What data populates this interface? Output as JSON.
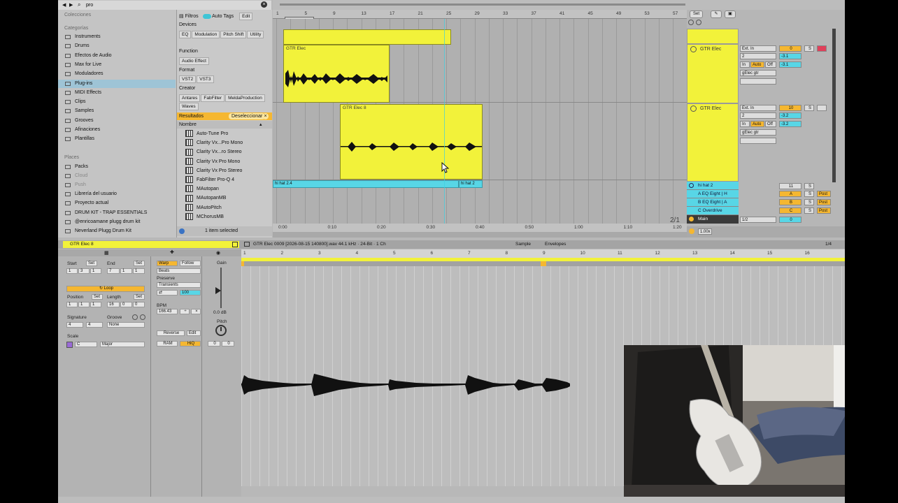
{
  "browser": {
    "search_value": "pro",
    "collections_header": "Colecciones",
    "categories_header": "Categorías",
    "categories": [
      "Instruments",
      "Drums",
      "Efectos de Audio",
      "Max for Live",
      "Moduladores",
      "Plug-ins",
      "MIDI Effects",
      "Clips",
      "Samples",
      "Grooves",
      "Afinaciones",
      "Plantillas"
    ],
    "selected_category": "Plug-ins",
    "places_header": "Places",
    "places": [
      "Packs",
      "Cloud",
      "Push",
      "Librería del usuario",
      "Proyecto actual",
      "DRUM KIT - TRAP ESSENTIALS",
      "@enricoamane plugg drum kit",
      "Neverland Plugg Drum Kit"
    ],
    "filters_label": "Filtros",
    "auto_tags_label": "Auto Tags",
    "edit_label": "Edit",
    "devices_label": "Devices",
    "device_tags": [
      "EQ",
      "Modulation",
      "Pitch Shift",
      "Utility"
    ],
    "function_label": "Function",
    "function_tags": [
      "Audio Effect"
    ],
    "format_label": "Format",
    "format_tags": [
      "VST2",
      "VST3"
    ],
    "creator_label": "Creator",
    "creator_tags": [
      "Antares",
      "FabFilter",
      "MeldaProduction",
      "Waves"
    ],
    "results_label": "Resultados",
    "deselect_label": "Deseleccionar",
    "name_header": "Nombre",
    "results": [
      "Auto-Tune Pro",
      "Clarity Vx...Pro Mono",
      "Clarity Vx...ro Stereo",
      "Clarity Vx Pro Mono",
      "Clarity Vx Pro Stereo",
      "FabFilter Pro-Q 4",
      "MAutopan",
      "MAutopanMB",
      "MAutoPitch",
      "MChorusMB"
    ],
    "status": "1 item selected"
  },
  "arrangement": {
    "ruler_marks": [
      "1",
      "5",
      "9",
      "13",
      "17",
      "21",
      "25",
      "29",
      "33",
      "37",
      "41",
      "45",
      "49",
      "53",
      "57"
    ],
    "set_label": "Set",
    "clips": {
      "clip_top": "",
      "clip_a": "GTR Elec",
      "clip_b": "GTR Elec 8",
      "clip_hi1": "hi hat 2.4",
      "clip_hi2": "hi hat 2"
    },
    "time_marks": [
      "0:00",
      "0:10",
      "0:20",
      "0:30",
      "0:40",
      "0:50",
      "1:00",
      "1:10",
      "1:20"
    ],
    "page_indicator": "2/1"
  },
  "mixer": {
    "tracks": [
      {
        "name": "GTR Elec",
        "input": "Ext. In",
        "channel": "2",
        "monitor": [
          "In",
          "Auto",
          "Off"
        ],
        "output": "gElec gtr",
        "volume": "0",
        "sends": [
          "-3.1",
          "-3.1"
        ]
      },
      {
        "name": "GTR Elec",
        "input": "Ext. In",
        "channel": "2",
        "monitor": [
          "In",
          "Auto",
          "Off"
        ],
        "output": "gElec gtr",
        "volume": "10",
        "sends": [
          "-3.2",
          "-3.2"
        ]
      }
    ],
    "hihat_track": "hi hat 2",
    "hihat_number": "11",
    "returns": [
      "A EQ Eight | H",
      "B EQ Eight | A",
      "C Overdrive"
    ],
    "return_letters": [
      "A",
      "B",
      "C"
    ],
    "post_label": "Post",
    "main_label": "Main",
    "main_sel": "1/2",
    "main_value": "0",
    "solo_label": "S",
    "zero_label": "1.00x"
  },
  "clip_view": {
    "clip_name": "GTR Elec 8",
    "file_info": "GTR Elec 0009 [2026-08-15 140800].wav   44.1 kHz · 24-Bit · 1 Ch",
    "tab_sample": "Sample",
    "tab_envelopes": "Envelopes",
    "page": "1/4",
    "start_label": "Start",
    "end_label": "End",
    "set_label": "Set",
    "start_value": [
      "1",
      "3",
      "1"
    ],
    "end_value": [
      "7",
      "1",
      "1"
    ],
    "loop_label": "Loop",
    "position_label": "Position",
    "length_label": "Length",
    "position_value": [
      "1",
      "1",
      "1"
    ],
    "length_value": [
      "16",
      "0",
      "0"
    ],
    "signature_label": "Signature",
    "signature": [
      "4",
      "4"
    ],
    "groove_label": "Groove",
    "groove_value": "None",
    "scale_label": "Scale",
    "scale_root": "C",
    "scale_type": "Major",
    "warp_label": "Warp",
    "follow_label": "Follow",
    "warp_mode": "Beats",
    "preserve_label": "Preserve",
    "preserve_mode": "Transients",
    "transient_value": "100",
    "bpm_label": "BPM",
    "bpm_value": "166.43",
    "reverse_label": "Reverse",
    "edit_label": "Edit",
    "ram_label": "RAM",
    "hiq_label": "HiQ",
    "gain_label": "Gain",
    "gain_value": "0.0 dB",
    "pitch_label": "Pitch",
    "pitch_values": [
      "0",
      "0"
    ],
    "ruler_marks": [
      "1",
      "2",
      "3",
      "4",
      "5",
      "6",
      "7",
      "8",
      "9",
      "10",
      "11",
      "12",
      "13",
      "14",
      "15",
      "16"
    ]
  }
}
